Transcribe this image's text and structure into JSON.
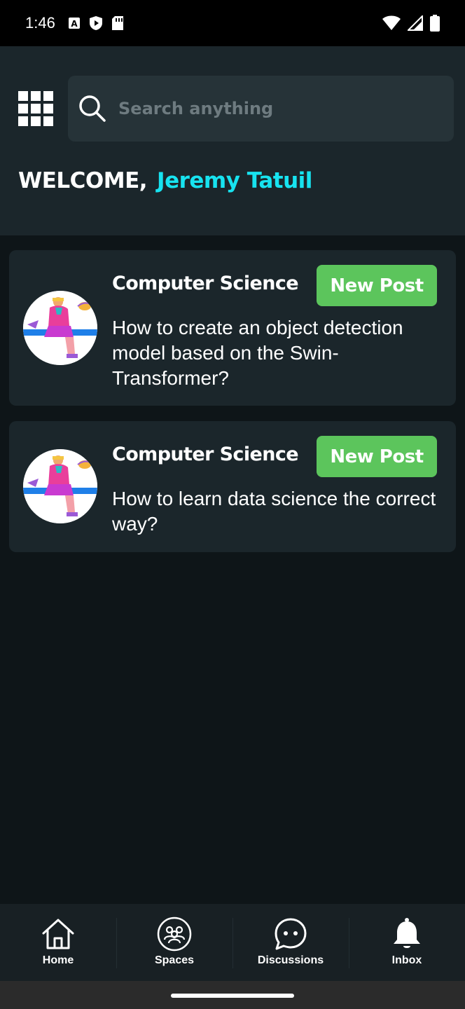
{
  "status_bar": {
    "time": "1:46",
    "left_icons": [
      "a-icon",
      "shield-play-icon",
      "sd-card-icon"
    ],
    "right_icons": [
      "wifi-icon",
      "signal-icon",
      "battery-icon"
    ]
  },
  "header": {
    "menu_icon": "grid-icon",
    "search": {
      "placeholder": "Search anything",
      "value": ""
    },
    "welcome_label": "WELCOME,",
    "user_name": "Jeremy Tatuil"
  },
  "posts": [
    {
      "space": "Computer Science",
      "badge": "New Post",
      "question": "How to create an object detection model based on the Swin-Transformer?"
    },
    {
      "space": "Computer Science",
      "badge": "New Post",
      "question": "How to learn data science the correct way?"
    }
  ],
  "bottom_nav": {
    "items": [
      {
        "label": "Home",
        "icon": "home-icon"
      },
      {
        "label": "Spaces",
        "icon": "people-icon"
      },
      {
        "label": "Discussions",
        "icon": "chat-icon"
      },
      {
        "label": "Inbox",
        "icon": "bell-icon"
      }
    ]
  },
  "colors": {
    "background": "#0e1518",
    "header": "#1b262b",
    "card": "#1b262b",
    "accent_name": "#17e3f0",
    "badge": "#5cc55c",
    "nav": "#182024"
  }
}
